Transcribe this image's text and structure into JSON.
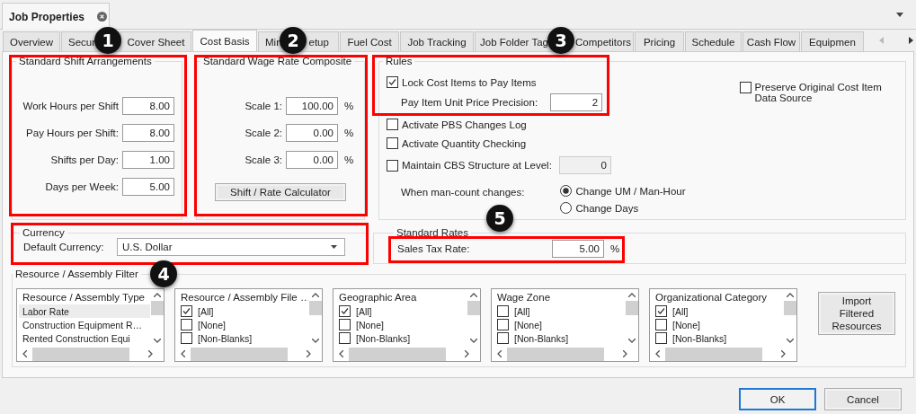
{
  "window": {
    "title": "Job Properties"
  },
  "tabs": [
    {
      "label_parts": [
        "Overview"
      ],
      "selected": false
    },
    {
      "label_parts": [
        "Secur"
      ],
      "selected": false
    },
    {
      "label_parts": [
        "Cover Sheet"
      ],
      "selected": false
    },
    {
      "label_parts": [
        "Cost Basis"
      ],
      "selected": true
    },
    {
      "label_parts": [
        "Min",
        "etup"
      ],
      "selected": false
    },
    {
      "label_parts": [
        "Fuel Cost"
      ],
      "selected": false
    },
    {
      "label_parts": [
        "Job Tracking"
      ],
      "selected": false
    },
    {
      "label_parts": [
        "Job Folder Tag"
      ],
      "selected": false
    },
    {
      "label_parts": [
        "Competitors"
      ],
      "selected": false
    },
    {
      "label_parts": [
        "Pricing"
      ],
      "selected": false
    },
    {
      "label_parts": [
        "Schedule"
      ],
      "selected": false
    },
    {
      "label_parts": [
        "Cash Flow"
      ],
      "selected": false
    },
    {
      "label_parts": [
        "Equipmen"
      ],
      "selected": false
    }
  ],
  "shift_group": {
    "title": "Standard Shift Arrangements",
    "fields": [
      {
        "label": "Work Hours per Shift",
        "value": "8.00"
      },
      {
        "label": "Pay Hours per Shift:",
        "value": "8.00"
      },
      {
        "label": "Shifts per Day:",
        "value": "1.00"
      },
      {
        "label": "Days per Week:",
        "value": "5.00"
      }
    ]
  },
  "wage_group": {
    "title": "Standard Wage Rate Composite",
    "scales": [
      {
        "label": "Scale 1:",
        "value": "100.00",
        "unit": "%"
      },
      {
        "label": "Scale 2:",
        "value": "0.00",
        "unit": "%"
      },
      {
        "label": "Scale 3:",
        "value": "0.00",
        "unit": "%"
      }
    ],
    "button": "Shift / Rate Calculator"
  },
  "rules": {
    "title": "Rules",
    "lock": {
      "label": "Lock Cost Items to Pay Items",
      "checked": true
    },
    "precision": {
      "label": "Pay Item Unit Price Precision:",
      "value": "2"
    },
    "preserve": {
      "label": "Preserve Original Cost Item Data Source",
      "checked": false
    },
    "options": [
      {
        "label": "Activate PBS Changes Log",
        "checked": false
      },
      {
        "label": "Activate Quantity Checking",
        "checked": false
      }
    ],
    "cbs": {
      "label": "Maintain CBS Structure at Level:",
      "checked": false,
      "value": "0",
      "disabled": true
    },
    "man_count": {
      "label": "When man-count changes:",
      "choices": [
        {
          "label": "Change UM / Man-Hour",
          "selected": true
        },
        {
          "label": "Change Days",
          "selected": false
        }
      ]
    }
  },
  "currency": {
    "title": "Currency",
    "label": "Default Currency:",
    "value": "U.S. Dollar"
  },
  "standard_rates": {
    "title": "Standard Rates",
    "label": "Sales Tax Rate:",
    "value": "5.00",
    "unit": "%"
  },
  "filter": {
    "title": "Resource / Assembly Filter",
    "button": "Import Filtered Resources",
    "lists": [
      {
        "header": "Resource / Assembly Type",
        "kind": "plain",
        "items": [
          {
            "label": "Labor Rate",
            "selected": true
          },
          {
            "label": "Construction Equipment R…",
            "selected": false
          },
          {
            "label": "Rented Construction Equi",
            "selected": false
          }
        ]
      },
      {
        "header": "Resource / Assembly File …",
        "kind": "check",
        "items": [
          {
            "label": "[All]",
            "checked": true
          },
          {
            "label": "[None]",
            "checked": false
          },
          {
            "label": "[Non-Blanks]",
            "checked": false
          }
        ]
      },
      {
        "header": "Geographic Area",
        "kind": "check",
        "items": [
          {
            "label": "[All]",
            "checked": true
          },
          {
            "label": "[None]",
            "checked": false
          },
          {
            "label": "[Non-Blanks]",
            "checked": false
          }
        ]
      },
      {
        "header": "Wage Zone",
        "kind": "check",
        "items": [
          {
            "label": "[All]",
            "checked": false
          },
          {
            "label": "[None]",
            "checked": false
          },
          {
            "label": "[Non-Blanks]",
            "checked": false
          }
        ]
      },
      {
        "header": "Organizational Category",
        "kind": "check",
        "items": [
          {
            "label": "[All]",
            "checked": true
          },
          {
            "label": "[None]",
            "checked": false
          },
          {
            "label": "[Non-Blanks]",
            "checked": false
          }
        ]
      }
    ]
  },
  "buttons": [
    {
      "label": "OK",
      "focused": true
    },
    {
      "label": "Cancel",
      "focused": false
    }
  ],
  "annotations": {
    "callouts": [
      "1",
      "2",
      "3",
      "4",
      "5"
    ]
  }
}
